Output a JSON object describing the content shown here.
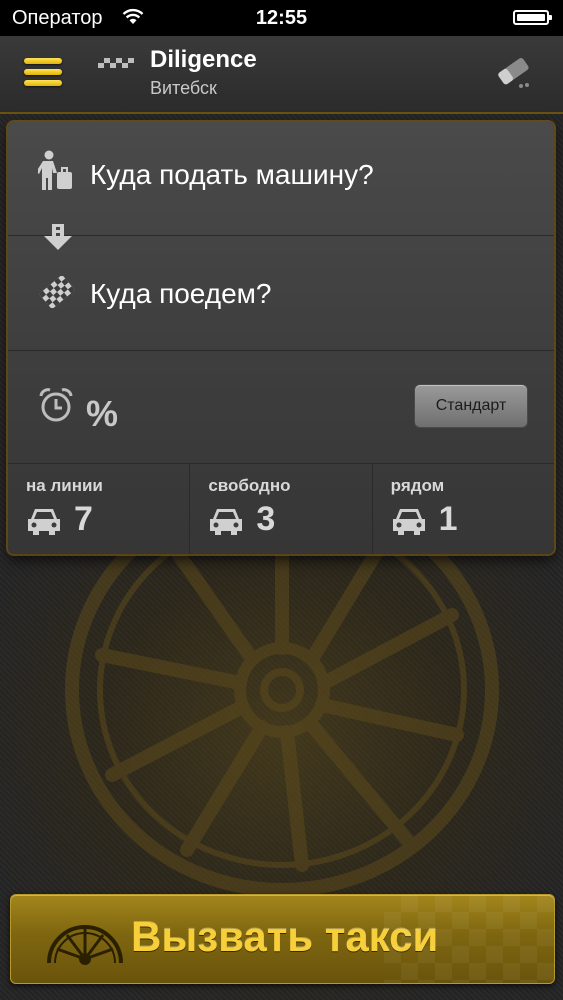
{
  "status_bar": {
    "carrier": "Оператор",
    "time": "12:55"
  },
  "header": {
    "title": "Diligence",
    "city": "Витебск"
  },
  "order": {
    "from_placeholder": "Куда подать машину?",
    "to_placeholder": "Куда поедем?",
    "percent_label": "%",
    "tariff_button": "Стандарт"
  },
  "stats": [
    {
      "label": "на линии",
      "value": "7"
    },
    {
      "label": "свободно",
      "value": "3"
    },
    {
      "label": "рядом",
      "value": "1"
    }
  ],
  "call_button": {
    "label": "Вызвать такси"
  },
  "colors": {
    "accent": "#f6cf3a",
    "menu": "#ffe35a",
    "brown": "#6a540c"
  }
}
